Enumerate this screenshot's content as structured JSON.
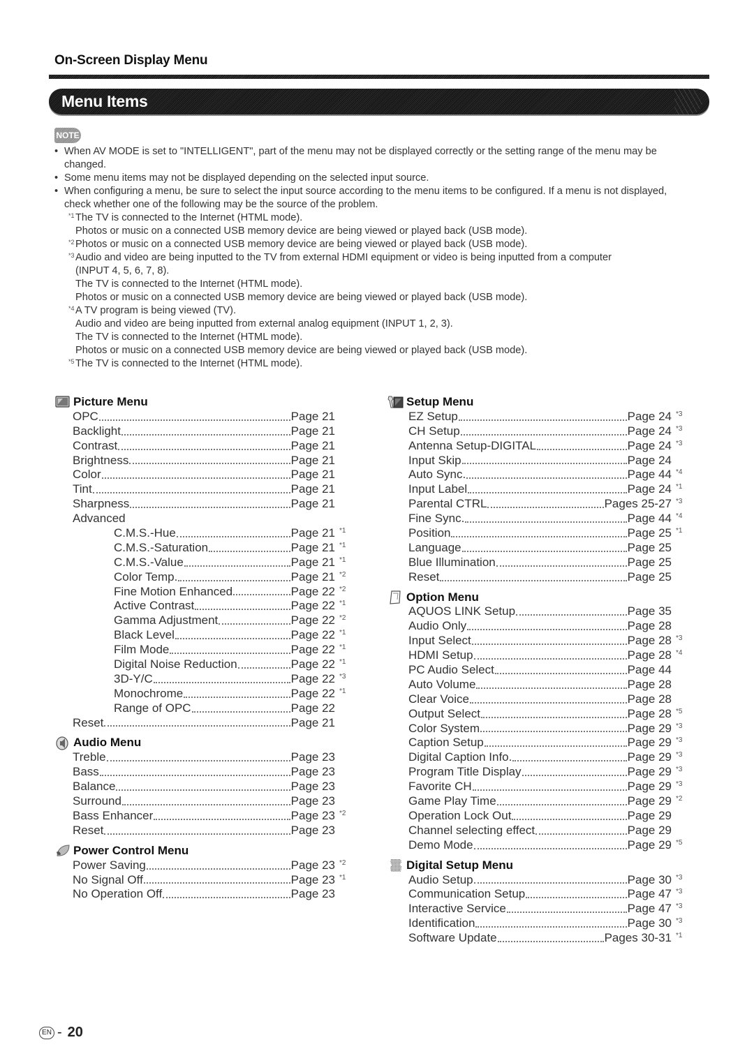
{
  "header": {
    "section_title": "On-Screen Display Menu",
    "banner_title": "Menu Items",
    "note_label": "NOTE"
  },
  "notes": {
    "bullets": [
      "When AV MODE is set to \"INTELLIGENT\", part of the menu may not be displayed correctly or the setting range of the menu may be changed.",
      "Some menu items may not be displayed depending on the selected input source.",
      "When configuring a menu, be sure to select the input source according to the menu items to be configured. If a menu is not displayed, check whether one of the following may be the source of the problem."
    ],
    "footnotes": [
      {
        "mark": "*1",
        "lines": [
          "The TV is connected to the Internet (HTML mode).",
          "Photos or music on a connected USB memory device are being viewed or played back (USB mode)."
        ]
      },
      {
        "mark": "*2",
        "lines": [
          "Photos or music on a connected USB memory device are being viewed or played back (USB mode)."
        ]
      },
      {
        "mark": "*3",
        "lines": [
          "Audio and video are being inputted to the TV from external HDMI equipment or video is being inputted from a computer",
          "(INPUT 4, 5, 6, 7, 8).",
          "The TV is connected to the Internet (HTML mode).",
          "Photos or music on a connected USB memory device are being viewed or played back (USB mode)."
        ]
      },
      {
        "mark": "*4",
        "lines": [
          "A TV program is being viewed (TV).",
          "Audio and video are being inputted from external analog equipment (INPUT 1, 2, 3).",
          "The TV is connected to the Internet (HTML mode).",
          "Photos or music on a connected USB memory device are being viewed or played back (USB mode)."
        ]
      },
      {
        "mark": "*5",
        "lines": [
          "The TV is connected to the Internet (HTML mode)."
        ]
      }
    ]
  },
  "menus": {
    "picture": {
      "title": "Picture Menu",
      "icon": "picture-menu-icon",
      "items": [
        {
          "name": "OPC",
          "page": "Page 21",
          "note": ""
        },
        {
          "name": "Backlight",
          "page": "Page 21",
          "note": ""
        },
        {
          "name": "Contrast",
          "page": "Page 21",
          "note": ""
        },
        {
          "name": "Brightness",
          "page": "Page 21",
          "note": ""
        },
        {
          "name": "Color",
          "page": "Page 21",
          "note": ""
        },
        {
          "name": "Tint",
          "page": "Page 21",
          "note": ""
        },
        {
          "name": "Sharpness",
          "page": "Page 21",
          "note": ""
        },
        {
          "name": "Advanced",
          "page": "",
          "note": ""
        }
      ],
      "advanced_items": [
        {
          "name": "C.M.S.-Hue",
          "page": "Page 21",
          "note": "*1"
        },
        {
          "name": "C.M.S.-Saturation",
          "page": "Page 21",
          "note": "*1"
        },
        {
          "name": "C.M.S.-Value",
          "page": "Page 21",
          "note": "*1"
        },
        {
          "name": "Color Temp.",
          "page": "Page 21",
          "note": "*2"
        },
        {
          "name": "Fine Motion Enhanced",
          "page": "Page 22",
          "note": "*2"
        },
        {
          "name": "Active Contrast",
          "page": "Page 22",
          "note": "*1"
        },
        {
          "name": "Gamma Adjustment",
          "page": "Page 22",
          "note": "*2"
        },
        {
          "name": "Black Level",
          "page": "Page 22",
          "note": "*1"
        },
        {
          "name": "Film Mode",
          "page": "Page 22",
          "note": "*1"
        },
        {
          "name": "Digital Noise Reduction",
          "page": "Page 22",
          "note": "*1"
        },
        {
          "name": "3D-Y/C",
          "page": "Page 22",
          "note": "*3"
        },
        {
          "name": "Monochrome",
          "page": "Page 22",
          "note": "*1"
        },
        {
          "name": "Range of OPC",
          "page": "Page 22",
          "note": ""
        }
      ],
      "tail_items": [
        {
          "name": "Reset",
          "page": "Page 21",
          "note": ""
        }
      ]
    },
    "audio": {
      "title": "Audio Menu",
      "icon": "speaker-icon",
      "items": [
        {
          "name": "Treble",
          "page": "Page 23",
          "note": ""
        },
        {
          "name": "Bass",
          "page": "Page 23",
          "note": ""
        },
        {
          "name": "Balance",
          "page": "Page 23",
          "note": ""
        },
        {
          "name": "Surround",
          "page": "Page 23",
          "note": ""
        },
        {
          "name": "Bass Enhancer",
          "page": "Page 23",
          "note": "*2"
        },
        {
          "name": "Reset",
          "page": "Page 23",
          "note": ""
        }
      ]
    },
    "power": {
      "title": "Power Control Menu",
      "icon": "leaf-icon",
      "items": [
        {
          "name": "Power Saving",
          "page": "Page 23",
          "note": "*2"
        },
        {
          "name": "No Signal Off",
          "page": "Page 23",
          "note": "*1"
        },
        {
          "name": "No Operation Off",
          "page": "Page 23",
          "note": ""
        }
      ]
    },
    "setup": {
      "title": "Setup Menu",
      "icon": "wrench-icon",
      "items": [
        {
          "name": "EZ Setup",
          "page": "Page 24",
          "note": "*3"
        },
        {
          "name": "CH Setup",
          "page": "Page 24",
          "note": "*3"
        },
        {
          "name": "Antenna Setup-DIGITAL",
          "page": "Page 24",
          "note": "*3"
        },
        {
          "name": "Input Skip",
          "page": "Page 24",
          "note": ""
        },
        {
          "name": "Auto Sync.",
          "page": "Page 44",
          "note": "*4"
        },
        {
          "name": "Input Label",
          "page": "Page 24",
          "note": "*1"
        },
        {
          "name": "Parental CTRL",
          "page": "Pages 25-27",
          "note": "*3"
        },
        {
          "name": "Fine Sync.",
          "page": "Page 44",
          "note": "*4"
        },
        {
          "name": "Position",
          "page": "Page 25",
          "note": "*1"
        },
        {
          "name": "Language",
          "page": "Page 25",
          "note": ""
        },
        {
          "name": "Blue Illumination",
          "page": "Page 25",
          "note": ""
        },
        {
          "name": "Reset",
          "page": "Page 25",
          "note": ""
        }
      ]
    },
    "option": {
      "title": "Option Menu",
      "icon": "notepad-icon",
      "items": [
        {
          "name": "AQUOS LINK Setup",
          "page": "Page 35",
          "note": ""
        },
        {
          "name": "Audio Only",
          "page": "Page 28",
          "note": ""
        },
        {
          "name": "Input Select",
          "page": "Page 28",
          "note": "*3"
        },
        {
          "name": "HDMI Setup",
          "page": "Page 28",
          "note": "*4"
        },
        {
          "name": "PC Audio Select",
          "page": "Page 44",
          "note": ""
        },
        {
          "name": "Auto Volume",
          "page": "Page 28",
          "note": ""
        },
        {
          "name": "Clear Voice",
          "page": "Page 28",
          "note": ""
        },
        {
          "name": "Output Select",
          "page": "Page 28",
          "note": "*5"
        },
        {
          "name": "Color System",
          "page": "Page 29",
          "note": "*3"
        },
        {
          "name": "Caption Setup",
          "page": "Page 29",
          "note": "*3"
        },
        {
          "name": "Digital Caption Info.",
          "page": "Page 29",
          "note": "*3"
        },
        {
          "name": "Program Title Display",
          "page": "Page 29",
          "note": "*3"
        },
        {
          "name": "Favorite CH",
          "page": "Page 29",
          "note": "*3"
        },
        {
          "name": "Game Play Time",
          "page": "Page 29",
          "note": "*2"
        },
        {
          "name": "Operation Lock Out",
          "page": "Page 29",
          "note": ""
        },
        {
          "name": "Channel selecting effect",
          "page": "Page 29",
          "note": ""
        },
        {
          "name": "Demo Mode",
          "page": "Page 29",
          "note": "*5"
        }
      ]
    },
    "digital": {
      "title": "Digital Setup Menu",
      "icon": "digital-setup-icon",
      "items": [
        {
          "name": "Audio Setup",
          "page": "Page 30",
          "note": "*3"
        },
        {
          "name": "Communication Setup",
          "page": "Page 47",
          "note": "*3"
        },
        {
          "name": "Interactive Service",
          "page": "Page 47",
          "note": "*3"
        },
        {
          "name": "Identification",
          "page": "Page 30",
          "note": "*3"
        },
        {
          "name": "Software Update",
          "page": "Pages 30-31",
          "note": "*1"
        }
      ]
    }
  },
  "footer": {
    "lang_badge": "EN",
    "dash": "-",
    "page_number": "20"
  }
}
